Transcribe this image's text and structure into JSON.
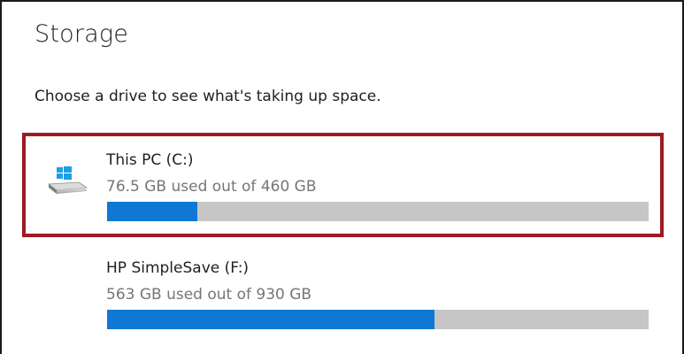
{
  "page": {
    "title": "Storage",
    "description": "Choose a drive to see what's taking up space."
  },
  "drives": [
    {
      "name": "This PC (C:)",
      "usage_text": "76.5 GB used out of 460 GB",
      "used_fraction": 0.166,
      "selected": true,
      "icon": "windows-drive-icon"
    },
    {
      "name": "HP SimpleSave (F:)",
      "usage_text": "563 GB used out of 930 GB",
      "used_fraction": 0.605,
      "selected": false,
      "icon": ""
    }
  ],
  "colors": {
    "accent": "#0f78d4",
    "bar_track": "#c6c6c6",
    "selection_border": "#9e1a22",
    "secondary_text": "#767676",
    "windows_logo": "#1a9fe8"
  }
}
